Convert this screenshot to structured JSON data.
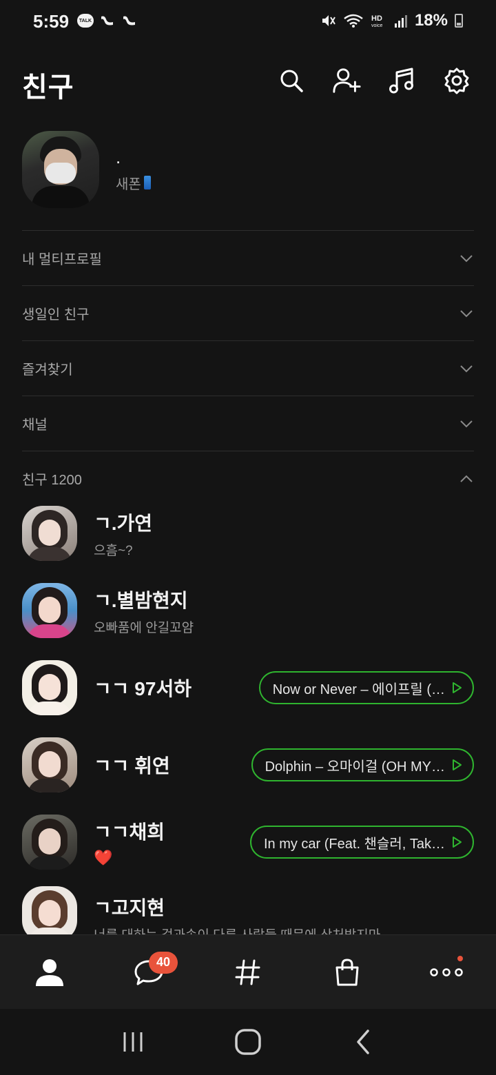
{
  "status_bar": {
    "time": "5:59",
    "talk_icon_text": "TALK",
    "battery": "18%"
  },
  "header": {
    "title": "친구",
    "icons": [
      "search-icon",
      "add-friend-icon",
      "music-icon",
      "settings-icon"
    ]
  },
  "my_profile": {
    "name": ".",
    "status": "새폰"
  },
  "sections": [
    {
      "label": "내 멀티프로필",
      "state": "collapsed"
    },
    {
      "label": "생일인 친구",
      "state": "collapsed"
    },
    {
      "label": "즐겨찾기",
      "state": "collapsed"
    },
    {
      "label": "채널",
      "state": "collapsed"
    },
    {
      "label": "친구 1200",
      "state": "expanded"
    }
  ],
  "friends": [
    {
      "name": "ㄱ.가연",
      "message": "으흠~?"
    },
    {
      "name": "ㄱ.별밤현지",
      "message": "오빠품에 안길꼬얌"
    },
    {
      "name": "ㄱㄱ 97서하",
      "music": "Now or Never – 에이프릴 (…"
    },
    {
      "name": "ㄱㄱ 휘연",
      "music": "Dolphin – 오마이걸 (OH MY…"
    },
    {
      "name": "ㄱㄱ채희",
      "message": "❤️",
      "music": "In my car (Feat. 챈슬러, Tak…"
    },
    {
      "name": "ㄱ고지현",
      "message": "너를 대하는 겉과속이 다른 사람들 때문에 상처받지마"
    }
  ],
  "bottom_nav": {
    "items": [
      "friends-tab",
      "chats-tab",
      "openchat-tab",
      "shopping-tab",
      "more-tab"
    ],
    "chat_badge": "40"
  },
  "colors": {
    "background": "#141414",
    "accent_green": "#2fb52f",
    "badge": "#e8533b"
  }
}
